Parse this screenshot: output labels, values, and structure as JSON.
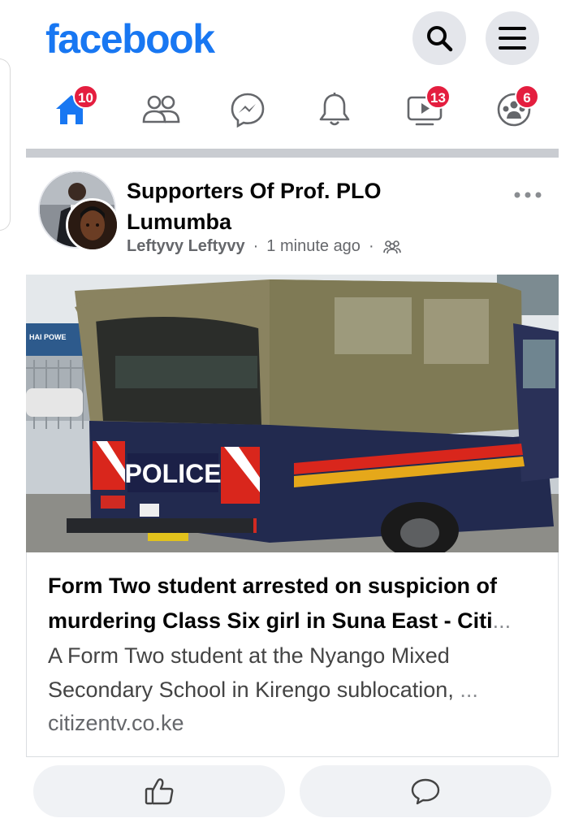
{
  "app": {
    "logo_text": "facebook",
    "brand_color": "#1877f2"
  },
  "header": {
    "search_icon": "search-icon",
    "menu_icon": "hamburger-menu-icon"
  },
  "nav": {
    "items": [
      {
        "name": "home",
        "icon": "home-icon",
        "badge": "10",
        "active": true
      },
      {
        "name": "friends",
        "icon": "friends-icon",
        "badge": ""
      },
      {
        "name": "messenger",
        "icon": "messenger-icon",
        "badge": ""
      },
      {
        "name": "notifications",
        "icon": "bell-icon",
        "badge": ""
      },
      {
        "name": "watch",
        "icon": "video-icon",
        "badge": "13"
      },
      {
        "name": "groups",
        "icon": "groups-icon",
        "badge": "6"
      }
    ],
    "badge_color": "#e41e3f"
  },
  "post": {
    "group_name": "Supporters Of Prof. PLO Lumumba",
    "author": "Leftyvy Leftyvy",
    "time": "1 minute ago",
    "separator": "·",
    "audience_icon": "group-members-icon",
    "image_text": {
      "police_label": "POLICE",
      "banner_text": "HAI POWE"
    },
    "link": {
      "headline": "Form Two student arrested on suspicion of murdering Class Six girl in Suna East - Citi",
      "headline_ellipsis": "...",
      "description": "A Form Two student at the Nyango Mixed Secondary School in Kirengo sublocation,",
      "description_ellipsis": "...",
      "domain": "citizentv.co.ke"
    },
    "actions": [
      {
        "name": "like",
        "icon": "thumbs-up-icon"
      },
      {
        "name": "comment",
        "icon": "comment-icon"
      }
    ]
  }
}
